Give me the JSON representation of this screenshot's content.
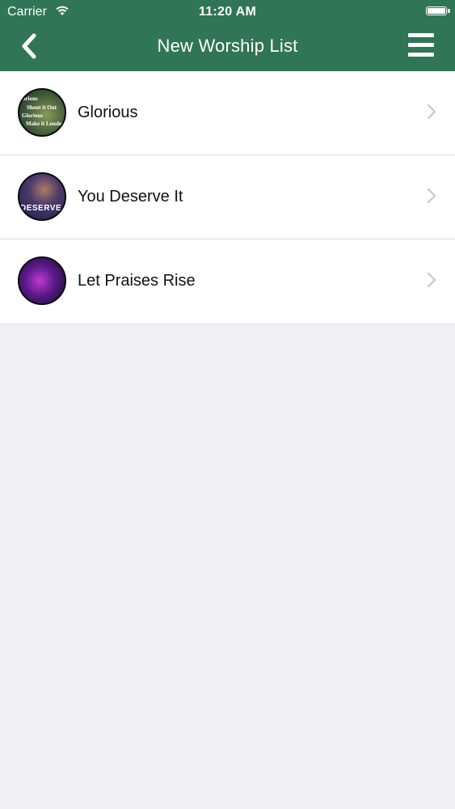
{
  "status_bar": {
    "carrier": "Carrier",
    "time": "11:20 AM"
  },
  "nav": {
    "title": "New Worship List",
    "back_icon": "chevron-left-icon",
    "menu_icon": "hamburger-menu-icon"
  },
  "theme": {
    "nav_color": "#2f7556",
    "background": "#efeff4"
  },
  "songs": [
    {
      "title": "Glorious",
      "thumbnail_lines": [
        "lorious",
        "Shout it Out",
        "Glorious",
        "Make it Louder"
      ]
    },
    {
      "title": "You Deserve It",
      "thumbnail_lines": [
        "DESERVE"
      ]
    },
    {
      "title": "Let Praises Rise",
      "thumbnail_lines": []
    }
  ]
}
